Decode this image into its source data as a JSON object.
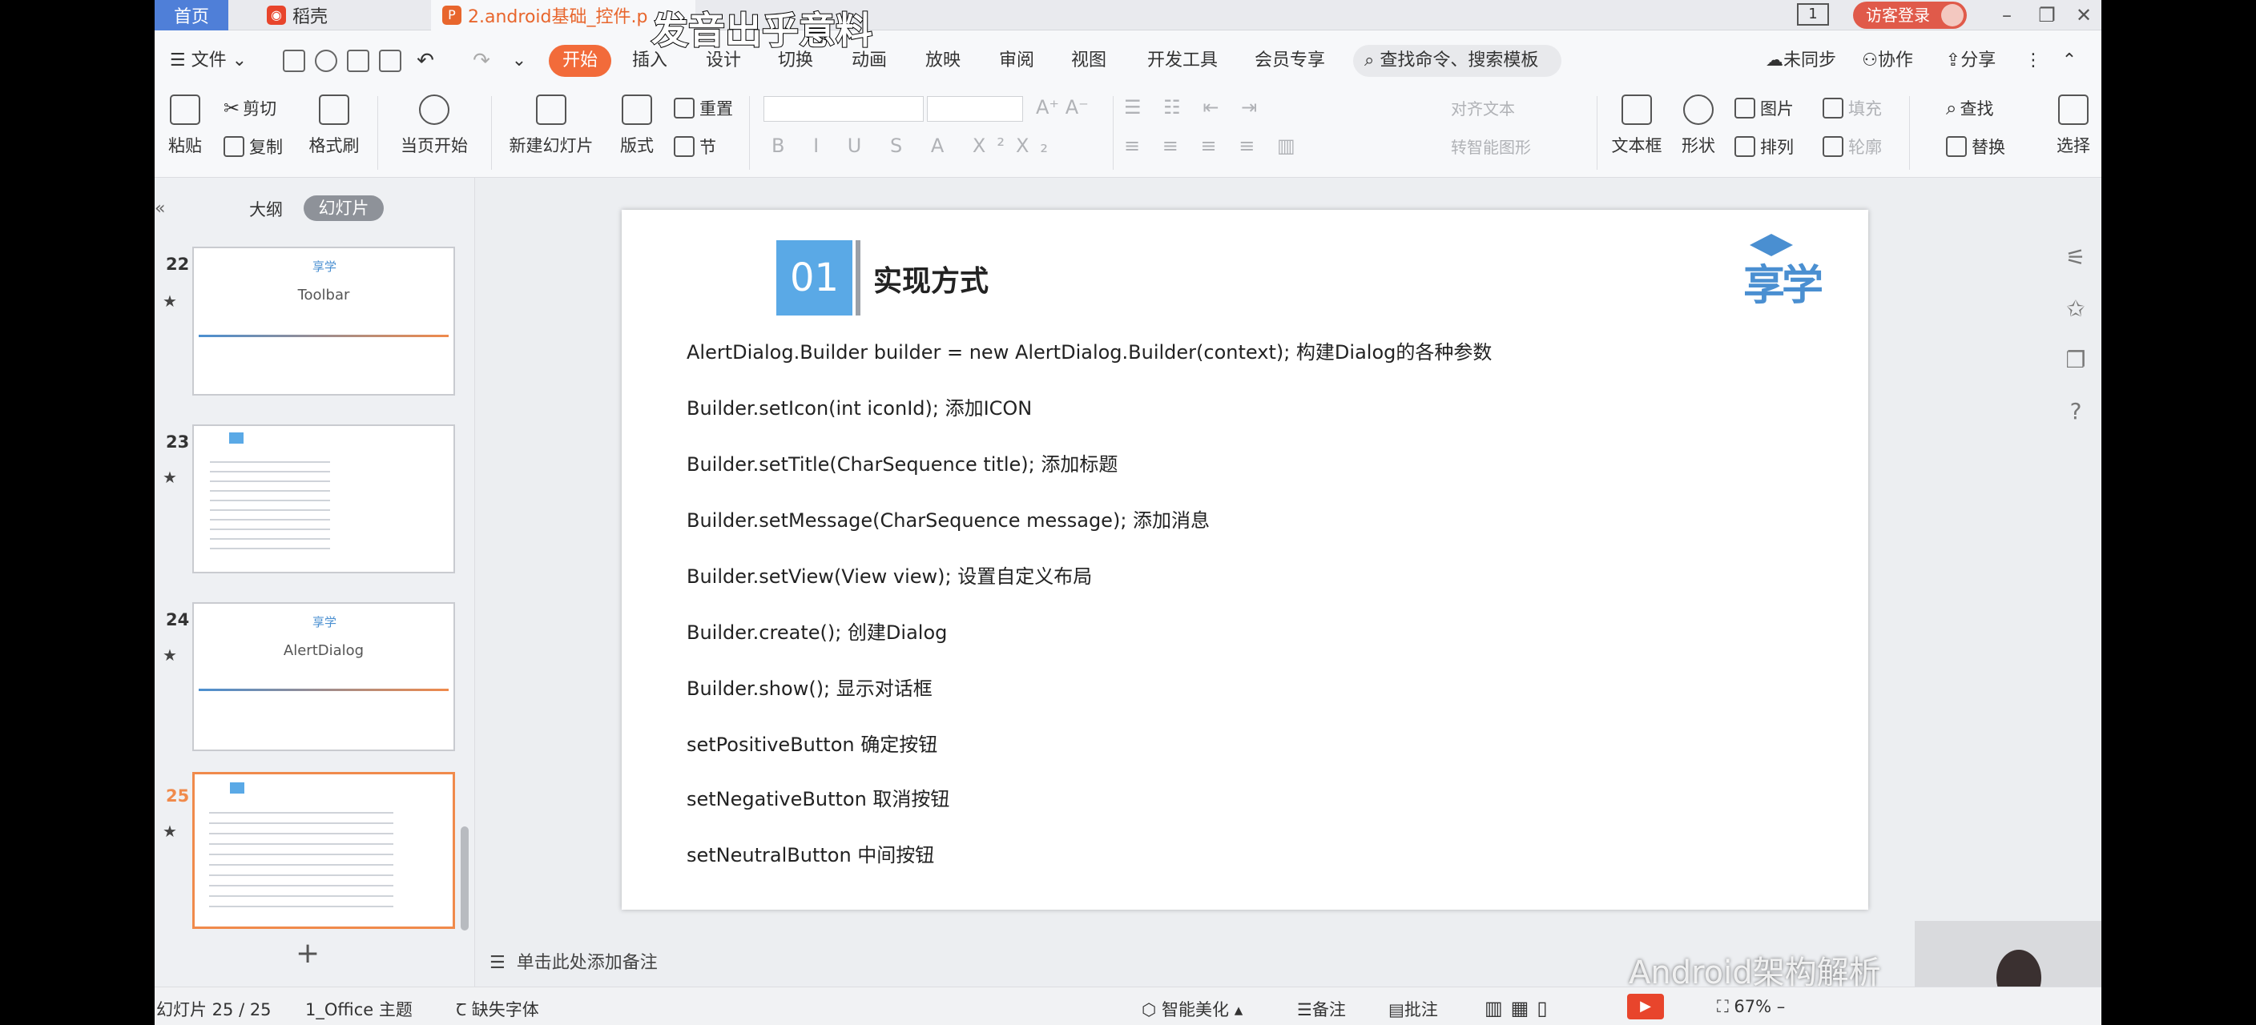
{
  "caption": "发音出乎意料",
  "tabs": {
    "home": "首页",
    "shell": "稻壳",
    "file": "2.android基础_控件.p"
  },
  "window": {
    "page_badge": "1",
    "login": "访客登录"
  },
  "menu": {
    "file": "文件",
    "items": [
      "开始",
      "插入",
      "设计",
      "切换",
      "动画",
      "放映",
      "审阅",
      "视图",
      "开发工具",
      "会员专享"
    ],
    "search": "查找命令、搜索模板",
    "sync": "未同步",
    "collab": "协作",
    "share": "分享"
  },
  "ribbon": {
    "paste": "粘贴",
    "cut": "剪切",
    "copy": "复制",
    "format_painter": "格式刷",
    "play_current": "当页开始",
    "new_slide": "新建幻灯片",
    "layout": "版式",
    "reset": "重置",
    "section": "节",
    "align_text": "对齐文本",
    "smart_shape": "转智能图形",
    "textbox": "文本框",
    "shape": "形状",
    "picture": "图片",
    "fill": "填充",
    "arrange": "排列",
    "outline": "轮廓",
    "find": "查找",
    "replace": "替换",
    "select": "选择"
  },
  "panel": {
    "outline_tab": "大纲",
    "slides_tab": "幻灯片",
    "thumbs": [
      {
        "num": "22",
        "title": "Toolbar"
      },
      {
        "num": "23",
        "title": ""
      },
      {
        "num": "24",
        "title": "AlertDialog"
      },
      {
        "num": "25",
        "title": ""
      }
    ],
    "add": "+"
  },
  "slide": {
    "number": "01",
    "heading": "实现方式",
    "logo": "享学",
    "lines": [
      "AlertDialog.Builder builder = new AlertDialog.Builder(context); 构建Dialog的各种参数",
      "Builder.setIcon(int iconId); 添加ICON",
      "Builder.setTitle(CharSequence title); 添加标题",
      "Builder.setMessage(CharSequence message); 添加消息",
      "Builder.setView(View view); 设置自定义布局",
      "Builder.create(); 创建Dialog",
      "Builder.show(); 显示对话框",
      "setPositiveButton  确定按钮",
      "setNegativeButton  取消按钮",
      "setNeutralButton  中间按钮"
    ]
  },
  "notes_placeholder": "单击此处添加备注",
  "watermark": "Android架构解析",
  "status": {
    "slide_count": "幻灯片 25 / 25",
    "theme": "1_Office 主题",
    "missing_font": "缺失字体",
    "beautify": "智能美化",
    "notes": "备注",
    "comments": "批注",
    "zoom": "67%"
  },
  "colors": {
    "accent": "#f08a4b",
    "slide_number_bg": "#5aa9e6",
    "start_tab": "#f26b3a"
  }
}
